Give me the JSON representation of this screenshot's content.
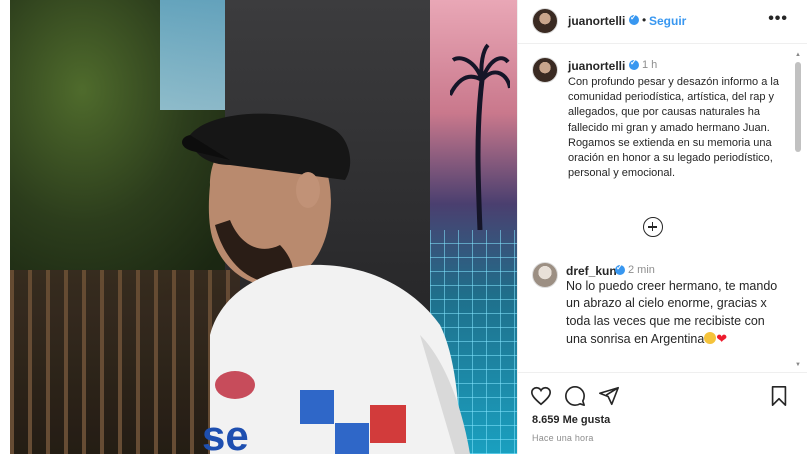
{
  "post": {
    "author": "juanortelli",
    "follow_label": "Seguir",
    "separator": "•",
    "more_label": "•••"
  },
  "caption": {
    "author": "juanortelli",
    "time": "1 h",
    "text": "Con profundo pesar y desazón informo a la comunidad periodística, artística, del rap y allegados, que por causas naturales ha fallecido mi gran y amado hermano Juan. Rogamos se extienda en su memoria una oración en honor a su legado periodístico, personal y emocional."
  },
  "comment": {
    "author": "dref_kun",
    "time": "2 min",
    "text": "No lo puedo creer hermano, te mando un abrazo al cielo enorme, gracias x toda las veces que me recibiste con una sonrisa en Argentina",
    "emoji_1": "",
    "emoji_2": "❤"
  },
  "footer": {
    "likes": "8.659 Me gusta",
    "posted": "Hace una hora"
  },
  "icons": {
    "like": "heart-icon",
    "comment": "comment-icon",
    "share": "share-icon",
    "save": "bookmark-icon",
    "add": "plus-circle-icon",
    "verified": "verified-badge-icon",
    "more": "more-options-icon"
  },
  "colors": {
    "link": "#3897f0",
    "verified": "#3897f0",
    "muted": "#8e8e8e",
    "text": "#262626",
    "heart": "#ed1c2e"
  }
}
